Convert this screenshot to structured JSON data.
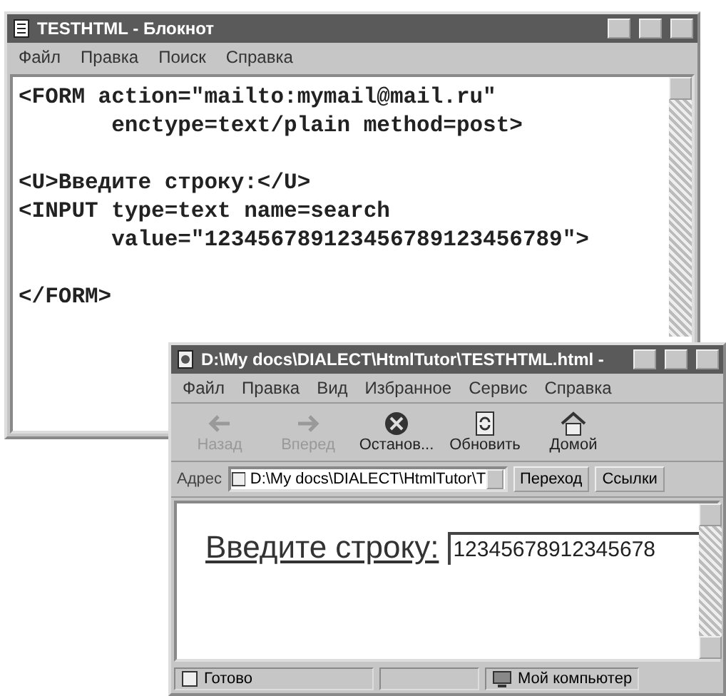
{
  "notepad": {
    "title": "TESTHTML - Блокнот",
    "menu": [
      "Файл",
      "Правка",
      "Поиск",
      "Справка"
    ],
    "lines": [
      {
        "text": "<FORM action=\"mailto:mymail@mail.ru\"",
        "blank_before": false
      },
      {
        "text": "       enctype=text/plain method=post>",
        "blank_before": false
      },
      {
        "text": "<U>Введите строку:</U>",
        "blank_before": true
      },
      {
        "text": "<INPUT type=text name=search",
        "blank_before": false
      },
      {
        "text": "       value=\"123456789123456789123456789\">",
        "blank_before": false
      },
      {
        "text": "</FORM>",
        "blank_before": true
      }
    ]
  },
  "browser": {
    "title": "D:\\My docs\\DIALECT\\HtmlTutor\\TESTHTML.html -",
    "menu": [
      "Файл",
      "Правка",
      "Вид",
      "Избранное",
      "Сервис",
      "Справка"
    ],
    "toolbar": [
      {
        "label": "Назад",
        "kind": "back",
        "disabled": true
      },
      {
        "label": "Вперед",
        "kind": "forward",
        "disabled": true
      },
      {
        "label": "Останов...",
        "kind": "stop",
        "disabled": false
      },
      {
        "label": "Обновить",
        "kind": "refresh",
        "disabled": false
      },
      {
        "label": "Домой",
        "kind": "home",
        "disabled": false
      }
    ],
    "address_label": "Адрес",
    "address": "D:\\My docs\\DIALECT\\HtmlTutor\\T",
    "go_button": "Переход",
    "links": "Ссылки",
    "page": {
      "label": "Введите строку:",
      "input_value": "12345678912345678"
    },
    "status_bar": {
      "status": "Готово",
      "zone": "Мой компьютер"
    }
  }
}
